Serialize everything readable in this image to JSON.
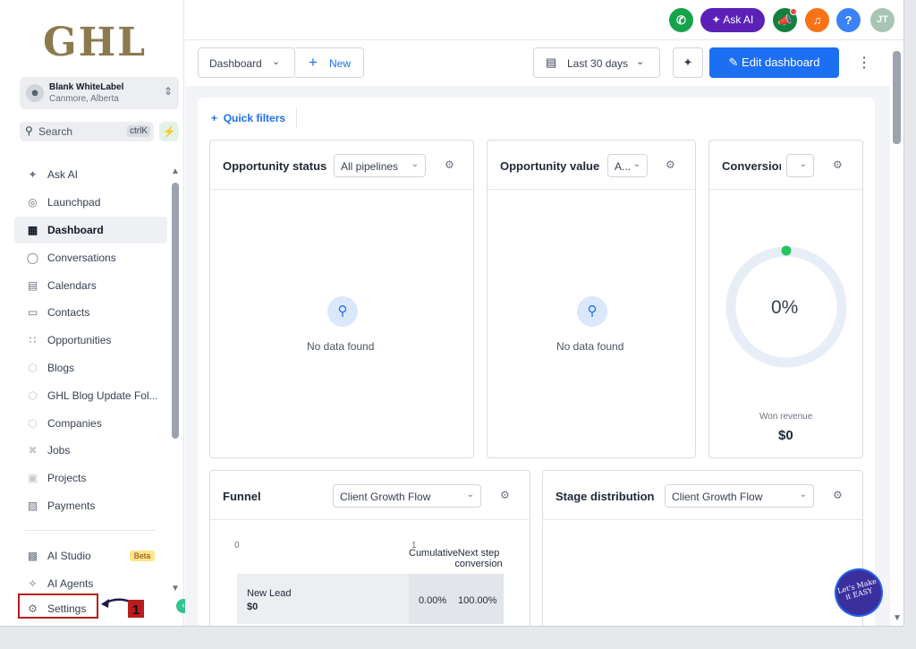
{
  "sidebar": {
    "logo": "GHL",
    "account": {
      "name": "Blank WhiteLabel",
      "location": "Canmore, Alberta"
    },
    "search": {
      "label": "Search",
      "shortcut": "ctrlK"
    },
    "items": [
      {
        "label": "Ask AI",
        "icon": "sparkle-icon"
      },
      {
        "label": "Launchpad",
        "icon": "rocket-icon"
      },
      {
        "label": "Dashboard",
        "icon": "grid-icon",
        "active": true
      },
      {
        "label": "Conversations",
        "icon": "chat-icon"
      },
      {
        "label": "Calendars",
        "icon": "calendar-icon"
      },
      {
        "label": "Contacts",
        "icon": "contacts-icon"
      },
      {
        "label": "Opportunities",
        "icon": "opportunities-icon"
      },
      {
        "label": "Blogs",
        "icon": "box-icon"
      },
      {
        "label": "GHL Blog Update Fol...",
        "icon": "box-icon"
      },
      {
        "label": "Companies",
        "icon": "box-icon"
      },
      {
        "label": "Jobs",
        "icon": "tools-icon"
      },
      {
        "label": "Projects",
        "icon": "projects-icon"
      },
      {
        "label": "Payments",
        "icon": "invoice-icon"
      }
    ],
    "bottom_items": [
      {
        "label": "AI Studio",
        "icon": "ai-studio-icon",
        "badge": "Beta"
      },
      {
        "label": "AI Agents",
        "icon": "sparkle-icon"
      },
      {
        "label": "Settings",
        "icon": "gear-icon"
      }
    ],
    "annotation_number": "1"
  },
  "topbar": {
    "ask_ai": "Ask AI",
    "avatar_initials": "JT",
    "help": "?"
  },
  "toolbar": {
    "dashboard_select": "Dashboard",
    "new_label": "New",
    "date_range": "Last 30 days",
    "edit_label": "Edit dashboard"
  },
  "quick_filters": "Quick filters",
  "widgets": {
    "opportunity_status": {
      "title": "Opportunity status",
      "select": "All pipelines",
      "empty": "No data found"
    },
    "opportunity_value": {
      "title": "Opportunity value",
      "select": "A...",
      "empty": "No data found"
    },
    "conversion": {
      "title": "Conversion",
      "value": "0%",
      "won_label": "Won revenue",
      "won_value": "$0"
    },
    "funnel": {
      "title": "Funnel",
      "select": "Client Growth Flow",
      "tick_start": "0",
      "tick_end": "1",
      "col_cumulative": "Cumulative",
      "col_next_step": "Next step conversion",
      "row": {
        "label": "New Lead",
        "value": "$0",
        "cumulative": "0.00%",
        "next_step": "100.00%"
      }
    },
    "stage_distribution": {
      "title": "Stage distribution",
      "select": "Client Growth Flow"
    }
  },
  "fab": {
    "text": "Let's Make it EASY"
  },
  "colors": {
    "primary": "#1d6ff2",
    "ask_ai": "#5b21b6",
    "annotation": "#b91c1c"
  }
}
